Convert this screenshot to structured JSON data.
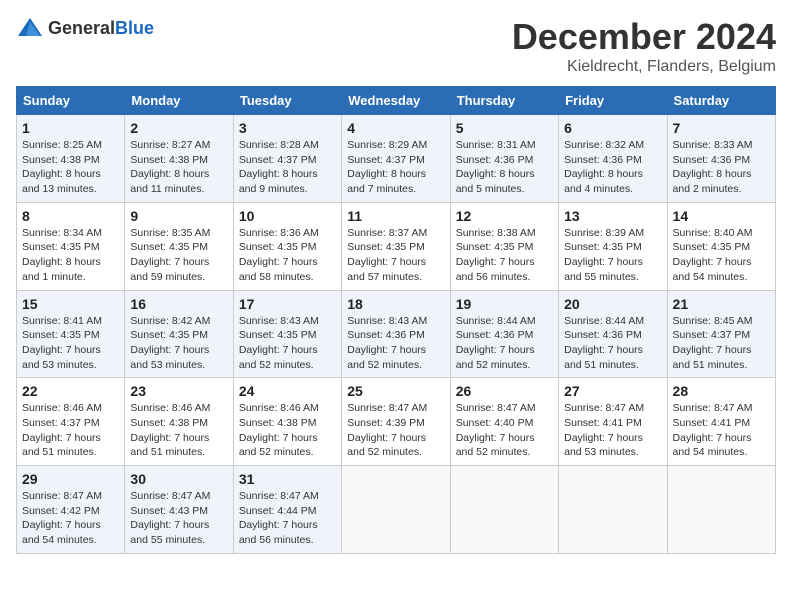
{
  "header": {
    "logo_general": "General",
    "logo_blue": "Blue",
    "month_title": "December 2024",
    "location": "Kieldrecht, Flanders, Belgium"
  },
  "weekdays": [
    "Sunday",
    "Monday",
    "Tuesday",
    "Wednesday",
    "Thursday",
    "Friday",
    "Saturday"
  ],
  "weeks": [
    [
      {
        "day": "1",
        "info": "Sunrise: 8:25 AM\nSunset: 4:38 PM\nDaylight: 8 hours\nand 13 minutes."
      },
      {
        "day": "2",
        "info": "Sunrise: 8:27 AM\nSunset: 4:38 PM\nDaylight: 8 hours\nand 11 minutes."
      },
      {
        "day": "3",
        "info": "Sunrise: 8:28 AM\nSunset: 4:37 PM\nDaylight: 8 hours\nand 9 minutes."
      },
      {
        "day": "4",
        "info": "Sunrise: 8:29 AM\nSunset: 4:37 PM\nDaylight: 8 hours\nand 7 minutes."
      },
      {
        "day": "5",
        "info": "Sunrise: 8:31 AM\nSunset: 4:36 PM\nDaylight: 8 hours\nand 5 minutes."
      },
      {
        "day": "6",
        "info": "Sunrise: 8:32 AM\nSunset: 4:36 PM\nDaylight: 8 hours\nand 4 minutes."
      },
      {
        "day": "7",
        "info": "Sunrise: 8:33 AM\nSunset: 4:36 PM\nDaylight: 8 hours\nand 2 minutes."
      }
    ],
    [
      {
        "day": "8",
        "info": "Sunrise: 8:34 AM\nSunset: 4:35 PM\nDaylight: 8 hours\nand 1 minute."
      },
      {
        "day": "9",
        "info": "Sunrise: 8:35 AM\nSunset: 4:35 PM\nDaylight: 7 hours\nand 59 minutes."
      },
      {
        "day": "10",
        "info": "Sunrise: 8:36 AM\nSunset: 4:35 PM\nDaylight: 7 hours\nand 58 minutes."
      },
      {
        "day": "11",
        "info": "Sunrise: 8:37 AM\nSunset: 4:35 PM\nDaylight: 7 hours\nand 57 minutes."
      },
      {
        "day": "12",
        "info": "Sunrise: 8:38 AM\nSunset: 4:35 PM\nDaylight: 7 hours\nand 56 minutes."
      },
      {
        "day": "13",
        "info": "Sunrise: 8:39 AM\nSunset: 4:35 PM\nDaylight: 7 hours\nand 55 minutes."
      },
      {
        "day": "14",
        "info": "Sunrise: 8:40 AM\nSunset: 4:35 PM\nDaylight: 7 hours\nand 54 minutes."
      }
    ],
    [
      {
        "day": "15",
        "info": "Sunrise: 8:41 AM\nSunset: 4:35 PM\nDaylight: 7 hours\nand 53 minutes."
      },
      {
        "day": "16",
        "info": "Sunrise: 8:42 AM\nSunset: 4:35 PM\nDaylight: 7 hours\nand 53 minutes."
      },
      {
        "day": "17",
        "info": "Sunrise: 8:43 AM\nSunset: 4:35 PM\nDaylight: 7 hours\nand 52 minutes."
      },
      {
        "day": "18",
        "info": "Sunrise: 8:43 AM\nSunset: 4:36 PM\nDaylight: 7 hours\nand 52 minutes."
      },
      {
        "day": "19",
        "info": "Sunrise: 8:44 AM\nSunset: 4:36 PM\nDaylight: 7 hours\nand 52 minutes."
      },
      {
        "day": "20",
        "info": "Sunrise: 8:44 AM\nSunset: 4:36 PM\nDaylight: 7 hours\nand 51 minutes."
      },
      {
        "day": "21",
        "info": "Sunrise: 8:45 AM\nSunset: 4:37 PM\nDaylight: 7 hours\nand 51 minutes."
      }
    ],
    [
      {
        "day": "22",
        "info": "Sunrise: 8:46 AM\nSunset: 4:37 PM\nDaylight: 7 hours\nand 51 minutes."
      },
      {
        "day": "23",
        "info": "Sunrise: 8:46 AM\nSunset: 4:38 PM\nDaylight: 7 hours\nand 51 minutes."
      },
      {
        "day": "24",
        "info": "Sunrise: 8:46 AM\nSunset: 4:38 PM\nDaylight: 7 hours\nand 52 minutes."
      },
      {
        "day": "25",
        "info": "Sunrise: 8:47 AM\nSunset: 4:39 PM\nDaylight: 7 hours\nand 52 minutes."
      },
      {
        "day": "26",
        "info": "Sunrise: 8:47 AM\nSunset: 4:40 PM\nDaylight: 7 hours\nand 52 minutes."
      },
      {
        "day": "27",
        "info": "Sunrise: 8:47 AM\nSunset: 4:41 PM\nDaylight: 7 hours\nand 53 minutes."
      },
      {
        "day": "28",
        "info": "Sunrise: 8:47 AM\nSunset: 4:41 PM\nDaylight: 7 hours\nand 54 minutes."
      }
    ],
    [
      {
        "day": "29",
        "info": "Sunrise: 8:47 AM\nSunset: 4:42 PM\nDaylight: 7 hours\nand 54 minutes."
      },
      {
        "day": "30",
        "info": "Sunrise: 8:47 AM\nSunset: 4:43 PM\nDaylight: 7 hours\nand 55 minutes."
      },
      {
        "day": "31",
        "info": "Sunrise: 8:47 AM\nSunset: 4:44 PM\nDaylight: 7 hours\nand 56 minutes."
      },
      {
        "day": "",
        "info": ""
      },
      {
        "day": "",
        "info": ""
      },
      {
        "day": "",
        "info": ""
      },
      {
        "day": "",
        "info": ""
      }
    ]
  ]
}
